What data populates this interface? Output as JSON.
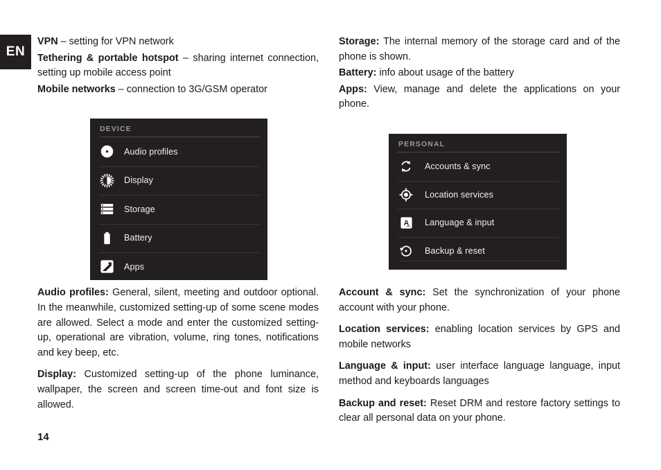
{
  "language_badge": "EN",
  "page_number": "14",
  "left_column": {
    "intro_paragraphs": [
      {
        "lead": "VPN",
        "text": " – setting for VPN network"
      },
      {
        "lead": "Tethering & portable hotspot",
        "text": " – sharing internet connection, setting up mobile access point"
      },
      {
        "lead": "Mobile networks",
        "text": " – connection to 3G/GSM operator"
      }
    ],
    "body_paragraphs": [
      {
        "lead": "Audio profiles:",
        "text": " General, silent, meeting and outdoor optional. In the meanwhile, customized setting-up of some scene modes are allowed. Select a mode and enter the customized setting-up, operational are vibration, volume, ring tones, notifications and key beep, etc."
      },
      {
        "lead": "Display:",
        "text": " Customized setting-up of the phone luminance, wallpaper, the screen and screen time-out and font size is allowed."
      }
    ]
  },
  "right_column": {
    "intro_paragraphs": [
      {
        "lead": "Storage:",
        "text": " The internal memory of the storage card and of the phone is shown."
      },
      {
        "lead": "Battery:",
        "text": " info about usage of the battery"
      },
      {
        "lead": "Apps:",
        "text": " View, manage and delete the applications on your phone."
      }
    ],
    "body_paragraphs": [
      {
        "lead": "Account & sync:",
        "text": " Set the synchronization of your phone account with your phone."
      },
      {
        "lead": "Location services:",
        "text": " enabling location services by GPS and mobile networks"
      },
      {
        "lead": "Language & input:",
        "text": " user interface language language, input method and keyboards languages"
      },
      {
        "lead": "Backup and reset:",
        "text": " Reset DRM and restore factory settings to clear all personal data on your phone."
      }
    ]
  },
  "device_panel": {
    "header": "DEVICE",
    "background_color": "#231f20",
    "rows": [
      {
        "icon": "audio-profiles-icon",
        "label": "Audio profiles"
      },
      {
        "icon": "display-brightness-icon",
        "label": "Display"
      },
      {
        "icon": "storage-icon",
        "label": "Storage"
      },
      {
        "icon": "battery-icon",
        "label": "Battery"
      },
      {
        "icon": "apps-icon",
        "label": "Apps"
      }
    ]
  },
  "personal_panel": {
    "header": "PERSONAL",
    "background_color": "#231f20",
    "rows": [
      {
        "icon": "sync-icon",
        "label": "Accounts & sync"
      },
      {
        "icon": "location-target-icon",
        "label": "Location services"
      },
      {
        "icon": "language-a-icon",
        "label": "Language & input"
      },
      {
        "icon": "backup-reset-icon",
        "label": "Backup & reset"
      }
    ]
  }
}
